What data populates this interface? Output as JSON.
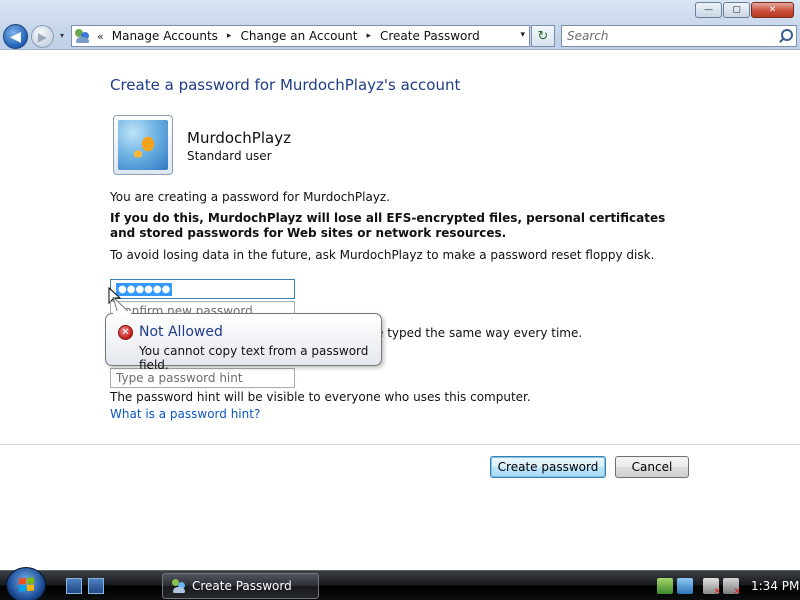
{
  "window": {
    "minimize_glyph": "—",
    "maximize_glyph": "▢",
    "close_glyph": "✕"
  },
  "nav": {
    "back_glyph": "◀",
    "forward_glyph": "▶",
    "history_glyph": "▾",
    "refresh_glyph": "↻"
  },
  "address_bar": {
    "overflow_glyph": "«",
    "breadcrumbs": [
      "Manage Accounts",
      "Change an Account",
      "Create Password"
    ],
    "separator_glyph": "▸",
    "dropdown_glyph": "▾"
  },
  "search": {
    "placeholder": "Search"
  },
  "content": {
    "title": "Create a password for MurdochPlayz's account",
    "user": {
      "name": "MurdochPlayz",
      "type": "Standard user"
    },
    "intro": "You are creating a password for MurdochPlayz.",
    "warning": "If you do this, MurdochPlayz will lose all EFS-encrypted files, personal certificates and stored passwords for Web sites or network resources.",
    "advice": "To avoid losing data in the future, ask MurdochPlayz to make a password reset floppy disk.",
    "new_password_value": "●●●●●●",
    "confirm_placeholder": "Confirm new password",
    "case_note_visible": "e typed the same way every time.",
    "hint_placeholder": "Type a password hint",
    "hint_visibility_note": "The password hint will be visible to everyone who uses this computer.",
    "hint_link": "What is a password hint?"
  },
  "buttons": {
    "create_password": "Create password",
    "cancel": "Cancel"
  },
  "balloon": {
    "icon_glyph": "✕",
    "title": "Not Allowed",
    "message": "You cannot copy text from a password field."
  },
  "taskbar": {
    "active_window": "Create Password",
    "clock": "1:34 PM"
  },
  "colors": {
    "title_blue": "#1e3c87",
    "link_blue": "#0b57c6",
    "selection_blue": "#3399ff",
    "error_red": "#c41c1c"
  },
  "icons": {
    "user_accounts": "user-accounts-icon",
    "search": "search-icon",
    "error": "error-icon",
    "avatar": "goldfish-avatar"
  }
}
